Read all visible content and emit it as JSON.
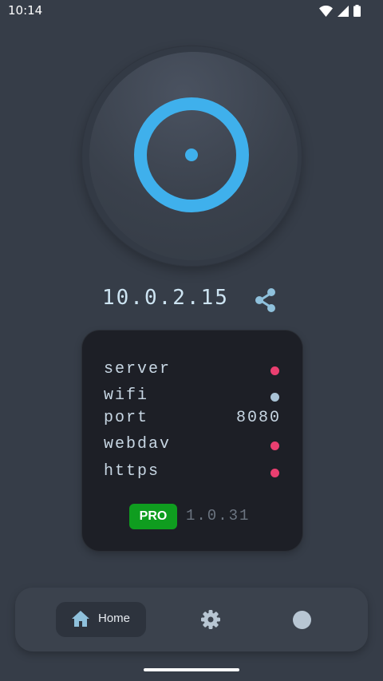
{
  "status_bar": {
    "time": "10:14",
    "icons": [
      "wifi-icon",
      "cell-signal-icon",
      "battery-icon"
    ]
  },
  "knob": {
    "icon": "power-ring-icon",
    "ring_color": "#3fb0ec"
  },
  "ip": {
    "address": "10.0.2.15",
    "share_icon": "share-icon"
  },
  "info": {
    "rows": [
      {
        "label": "server",
        "status_color": "#ea3f70"
      },
      {
        "label": "wifi",
        "status_color": "#a9c3d6"
      },
      {
        "label": "port",
        "value": "8080"
      },
      {
        "label": "webdav",
        "status_color": "#ea3f70"
      },
      {
        "label": "https",
        "status_color": "#ea3f70"
      }
    ],
    "badge": "PRO",
    "badge_color": "#0f9d1f",
    "version": "1.0.31"
  },
  "nav": {
    "home_label": "Home",
    "items": [
      "home-icon",
      "gear-icon",
      "about-icon"
    ]
  },
  "colors": {
    "background": "#363d48",
    "card": "#1d1f26",
    "accent": "#3fb0ec"
  }
}
